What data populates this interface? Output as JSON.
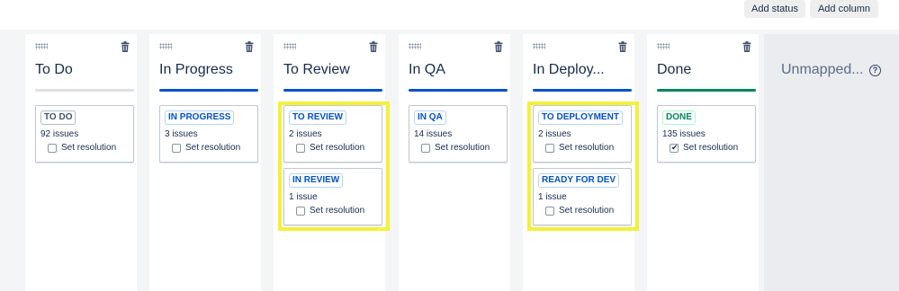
{
  "toolbar": {
    "add_status_label": "Add status",
    "add_column_label": "Add column"
  },
  "colors": {
    "grey_bar": "#dfe1e6",
    "blue_bar": "#0052cc",
    "green_bar": "#00875a",
    "highlight": "#f4f03a"
  },
  "columns": [
    {
      "title": "To Do",
      "bar": "grey",
      "statuses": [
        {
          "status": "TO DO",
          "lozenge": "grey",
          "issues": "92 issues",
          "resolution_label": "Set resolution",
          "checked": false
        }
      ]
    },
    {
      "title": "In Progress",
      "bar": "blue",
      "statuses": [
        {
          "status": "IN PROGRESS",
          "lozenge": "blue",
          "issues": "3 issues",
          "resolution_label": "Set resolution",
          "checked": false
        }
      ]
    },
    {
      "title": "To Review",
      "bar": "blue",
      "highlighted": true,
      "statuses": [
        {
          "status": "TO REVIEW",
          "lozenge": "blue",
          "issues": "2 issues",
          "resolution_label": "Set resolution",
          "checked": false
        },
        {
          "status": "IN REVIEW",
          "lozenge": "blue",
          "issues": "1 issue",
          "resolution_label": "Set resolution",
          "checked": false
        }
      ]
    },
    {
      "title": "In QA",
      "bar": "blue",
      "statuses": [
        {
          "status": "IN QA",
          "lozenge": "blue",
          "issues": "14 issues",
          "resolution_label": "Set resolution",
          "checked": false
        }
      ]
    },
    {
      "title": "In Deploy...",
      "bar": "blue",
      "highlighted": true,
      "statuses": [
        {
          "status": "TO DEPLOYMENT",
          "lozenge": "blue",
          "issues": "2 issues",
          "resolution_label": "Set resolution",
          "checked": false
        },
        {
          "status": "READY FOR DEV",
          "lozenge": "blue",
          "issues": "1 issue",
          "resolution_label": "Set resolution",
          "checked": false
        }
      ]
    },
    {
      "title": "Done",
      "bar": "green",
      "statuses": [
        {
          "status": "DONE",
          "lozenge": "green",
          "issues": "135 issues",
          "resolution_label": "Set resolution",
          "checked": true
        }
      ]
    }
  ],
  "unmapped": {
    "title": "Unmapped...",
    "help_icon": "?"
  },
  "icons": {
    "drag": "drag-handle-icon",
    "trash": "trash-icon",
    "help": "help-icon"
  }
}
